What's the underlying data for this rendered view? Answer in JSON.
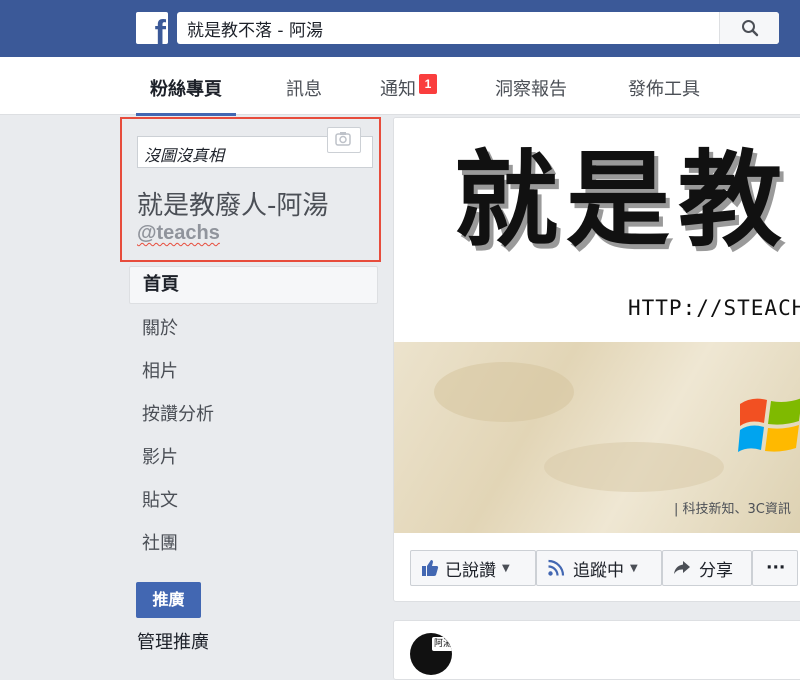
{
  "topbar": {
    "logo_letter": "f",
    "search_value": "就是教不落 - 阿湯"
  },
  "tabs": [
    {
      "label": "粉絲專頁"
    },
    {
      "label": "訊息"
    },
    {
      "label": "通知",
      "badge": "1"
    },
    {
      "label": "洞察報告"
    },
    {
      "label": "發佈工具"
    }
  ],
  "profile": {
    "picture_alt": "沒圖沒真相",
    "name": "就是教廢人-阿湯",
    "handle": "@teachs"
  },
  "nav": [
    {
      "label": "首頁"
    },
    {
      "label": "關於"
    },
    {
      "label": "相片"
    },
    {
      "label": "按讚分析"
    },
    {
      "label": "影片"
    },
    {
      "label": "貼文"
    },
    {
      "label": "社團"
    }
  ],
  "promote": {
    "button_label": "推廣",
    "manage_label": "管理推廣"
  },
  "cover": {
    "title": "就是教",
    "url": "HTTP://STEACH",
    "tagline": "| 科技新知、3C資訊"
  },
  "actions": {
    "like": "已說讚",
    "follow": "追蹤中",
    "share": "分享",
    "more": "···"
  },
  "post": {
    "avatar_text": "阿湯"
  },
  "colors": {
    "fb_blue": "#3b5998",
    "accent": "#4267b2",
    "badge_red": "#fa3e3e",
    "highlight_red": "#e74c3c"
  }
}
